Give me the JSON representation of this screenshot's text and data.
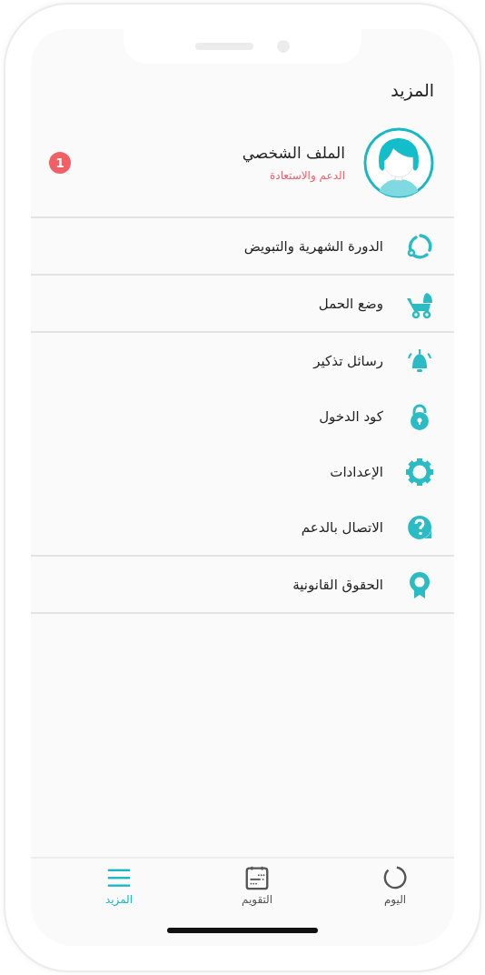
{
  "header": {
    "title": "المزيد"
  },
  "profile": {
    "name": "الملف الشخصي",
    "subtitle": "الدعم والاستعادة",
    "badge": "1"
  },
  "sections": [
    [
      {
        "kind": "cycle",
        "label": "الدورة الشهرية والتبويض"
      }
    ],
    [
      {
        "kind": "stroller",
        "label": "وضع الحمل"
      }
    ],
    [
      {
        "kind": "bell",
        "label": "رسائل تذكير"
      },
      {
        "kind": "lock",
        "label": "كود الدخول"
      },
      {
        "kind": "gear",
        "label": "الإعدادات"
      },
      {
        "kind": "question",
        "label": "الاتصال بالدعم"
      }
    ],
    [
      {
        "kind": "ribbon",
        "label": "الحقوق القانونية"
      }
    ]
  ],
  "tabs": [
    {
      "kind": "today",
      "label": "اليوم",
      "selected": false
    },
    {
      "kind": "calendar",
      "label": "التقويم",
      "selected": false
    },
    {
      "kind": "menu",
      "label": "المزيد",
      "selected": true
    }
  ]
}
